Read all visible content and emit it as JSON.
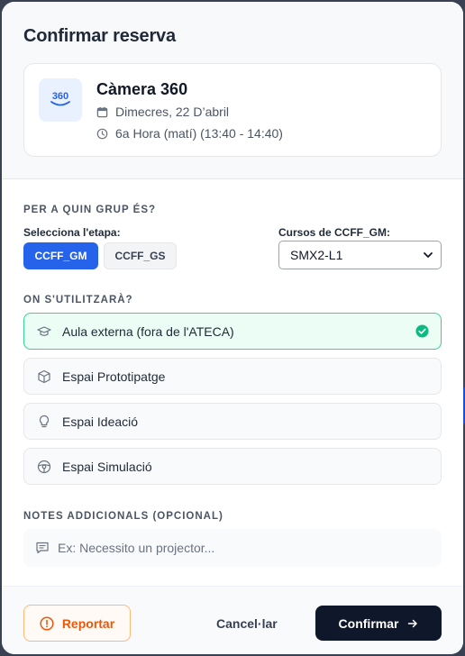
{
  "modal": {
    "title": "Confirmar reserva"
  },
  "resource": {
    "icon_text": "360",
    "name": "Càmera 360",
    "date": "Dimecres, 22 D’abril",
    "time": "6a Hora (matí) (13:40 - 14:40)"
  },
  "group": {
    "heading": "PER A QUIN GRUP ÉS?",
    "stage_label": "Selecciona l'etapa:",
    "stages": [
      {
        "label": "CCFF_GM",
        "active": true
      },
      {
        "label": "CCFF_GS",
        "active": false
      }
    ],
    "course_label": "Cursos de CCFF_GM:",
    "course_value": "SMX2-L1"
  },
  "location": {
    "heading": "ON S'UTILITZARÀ?",
    "options": [
      {
        "label": "Aula externa (fora de l'ATECA)",
        "icon": "graduation-cap-icon",
        "selected": true
      },
      {
        "label": "Espai Prototipatge",
        "icon": "cube-icon",
        "selected": false
      },
      {
        "label": "Espai Ideació",
        "icon": "lightbulb-icon",
        "selected": false
      },
      {
        "label": "Espai Simulació",
        "icon": "steering-wheel-icon",
        "selected": false
      }
    ]
  },
  "notes": {
    "heading": "NOTES ADDICIONALS (OPCIONAL)",
    "placeholder": "Ex: Necessito un projector...",
    "value": ""
  },
  "footer": {
    "report_label": "Reportar",
    "cancel_label": "Cancel·lar",
    "confirm_label": "Confirmar"
  },
  "colors": {
    "primary": "#2563eb",
    "success": "#10b981",
    "warning": "#ea580c",
    "dark": "#0f172a"
  }
}
